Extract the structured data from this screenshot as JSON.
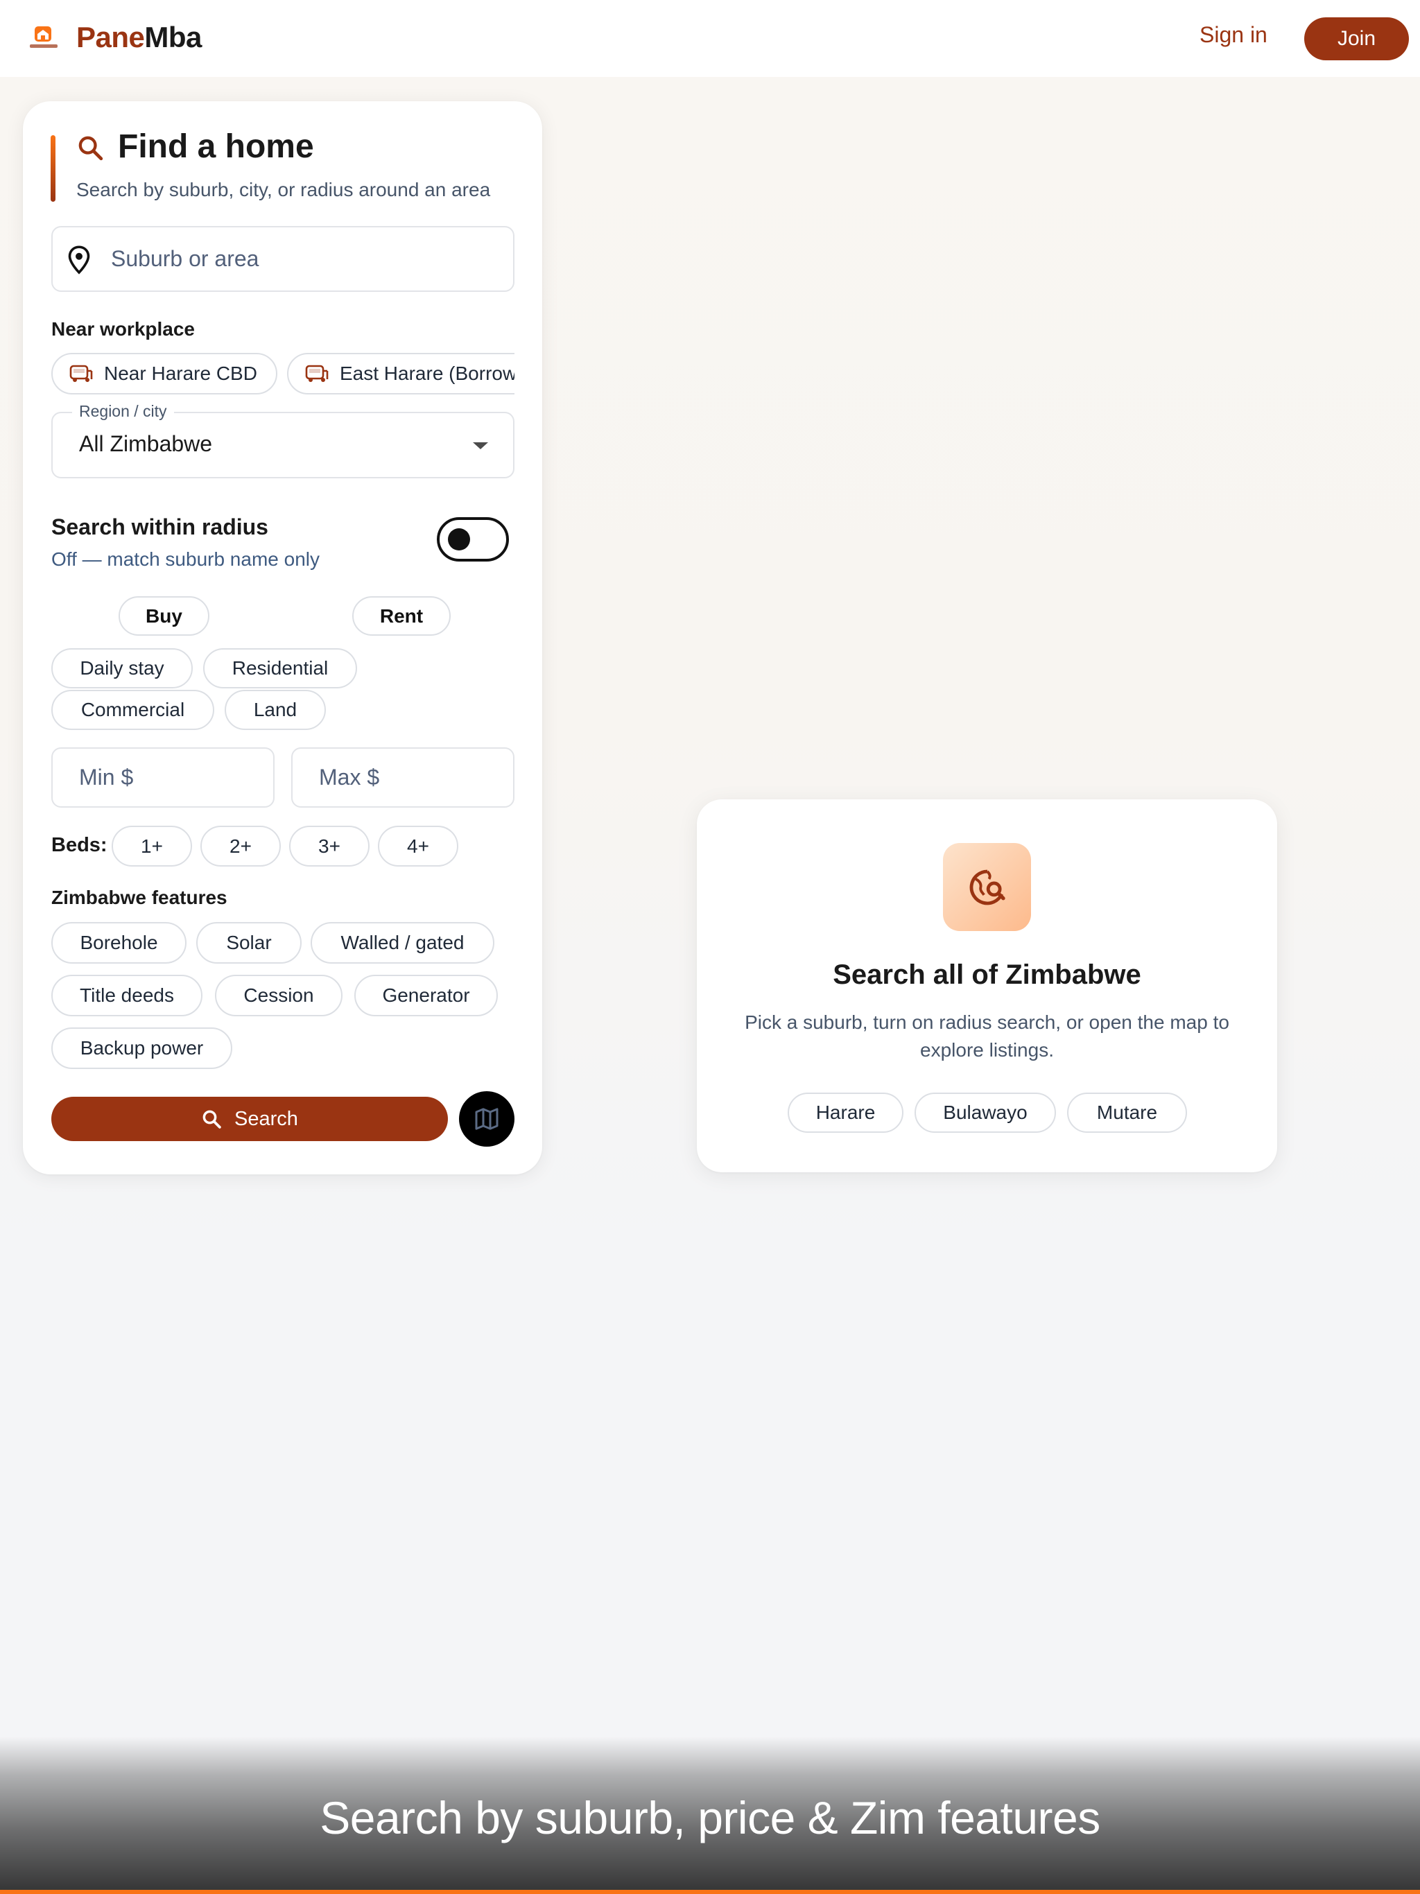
{
  "header": {
    "brand_part1": "Pane",
    "brand_part2": "Mba",
    "sign_in": "Sign in",
    "join": "Join"
  },
  "search_panel": {
    "title": "Find a home",
    "subtitle": "Search by suburb, city, or radius around an area",
    "suburb_placeholder": "Suburb or area",
    "near_workplace_label": "Near workplace",
    "workplace_chips": [
      "Near Harare CBD",
      "East Harare (Borrow"
    ],
    "region_label": "Region / city",
    "region_value": "All Zimbabwe",
    "radius_label": "Search within radius",
    "radius_status": "Off — match suburb name only",
    "radius_enabled": false,
    "listing_modes": [
      "Buy",
      "Rent"
    ],
    "property_types": [
      "Daily stay",
      "Residential",
      "Commercial",
      "Land"
    ],
    "min_price_placeholder": "Min $",
    "max_price_placeholder": "Max $",
    "beds_label": "Beds:",
    "beds_options": [
      "1+",
      "2+",
      "3+",
      "4+"
    ],
    "features_label": "Zimbabwe features",
    "features": [
      "Borehole",
      "Solar",
      "Walled / gated",
      "Title deeds",
      "Cession",
      "Generator",
      "Backup power"
    ],
    "search_button": "Search"
  },
  "empty_state": {
    "title": "Search all of Zimbabwe",
    "description": "Pick a suburb, turn on radius search, or open the map to explore listings.",
    "cities": [
      "Harare",
      "Bulawayo",
      "Mutare"
    ]
  },
  "caption": "Search by suburb, price & Zim features",
  "colors": {
    "brand": "#9a3412",
    "accent": "#f97316",
    "text_muted": "#475569"
  },
  "icons": [
    "home-logo-icon",
    "search-icon",
    "map-pin-icon",
    "bus-icon",
    "dropdown-arrow-icon",
    "map-icon",
    "globe-search-icon"
  ]
}
